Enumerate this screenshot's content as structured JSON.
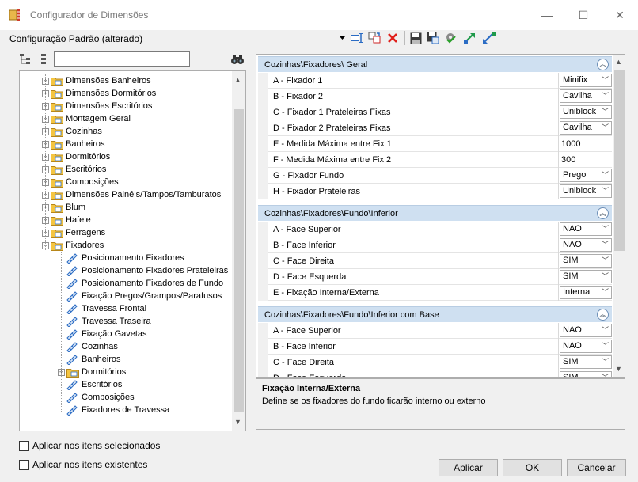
{
  "window": {
    "title": "Configurador de Dimensões",
    "minimize": "—",
    "maximize": "☐",
    "close": "✕"
  },
  "header": {
    "config_label": "Configuração Padrão (alterado)"
  },
  "search": {
    "value": "",
    "placeholder": ""
  },
  "tree": {
    "nodes": [
      {
        "label": "Dimensões Banheiros",
        "type": "folder",
        "expander": "+"
      },
      {
        "label": "Dimensões Dormitórios",
        "type": "folder",
        "expander": "+"
      },
      {
        "label": "Dimensões Escritórios",
        "type": "folder",
        "expander": "+"
      },
      {
        "label": "Montagem Geral",
        "type": "folder",
        "expander": "+"
      },
      {
        "label": "Cozinhas",
        "type": "folder",
        "expander": "+"
      },
      {
        "label": "Banheiros",
        "type": "folder",
        "expander": "+"
      },
      {
        "label": "Dormitórios",
        "type": "folder",
        "expander": "+"
      },
      {
        "label": "Escritórios",
        "type": "folder",
        "expander": "+"
      },
      {
        "label": "Composições",
        "type": "folder",
        "expander": "+"
      },
      {
        "label": "Dimensões Painéis/Tampos/Tamburatos",
        "type": "folder",
        "expander": "+"
      },
      {
        "label": "Blum",
        "type": "folder",
        "expander": "+"
      },
      {
        "label": "Hafele",
        "type": "folder",
        "expander": "+"
      },
      {
        "label": "Ferragens",
        "type": "folder",
        "expander": "+"
      },
      {
        "label": "Fixadores",
        "type": "folder",
        "expander": "−"
      },
      {
        "label": "Posicionamento Fixadores",
        "type": "leaf"
      },
      {
        "label": "Posicionamento Fixadores Prateleiras",
        "type": "leaf"
      },
      {
        "label": "Posicionamento Fixadores de Fundo",
        "type": "leaf"
      },
      {
        "label": "Fixação Pregos/Grampos/Parafusos",
        "type": "leaf"
      },
      {
        "label": "Travessa Frontal",
        "type": "leaf"
      },
      {
        "label": "Travessa Traseira",
        "type": "leaf"
      },
      {
        "label": "Fixação Gavetas",
        "type": "leaf"
      },
      {
        "label": "Cozinhas",
        "type": "leaf"
      },
      {
        "label": "Banheiros",
        "type": "leaf"
      },
      {
        "label": "Dormitórios",
        "type": "folder",
        "expander": "+"
      },
      {
        "label": "Escritórios",
        "type": "leaf"
      },
      {
        "label": "Composições",
        "type": "leaf"
      },
      {
        "label": "Fixadores de Travessa",
        "type": "leaf"
      }
    ]
  },
  "grid": {
    "categories": [
      {
        "title": "Cozinhas\\Fixadores\\ Geral",
        "collapse": "︽",
        "rows": [
          {
            "name": "A - Fixador 1",
            "value": "Minifix",
            "combo": true
          },
          {
            "name": "B - Fixador 2",
            "value": "Cavilha",
            "combo": true
          },
          {
            "name": "C - Fixador 1 Prateleiras Fixas",
            "value": "Uniblock",
            "combo": true
          },
          {
            "name": "D - Fixador 2 Prateleiras Fixas",
            "value": "Cavilha",
            "combo": true
          },
          {
            "name": "E - Medida Máxima entre Fix 1",
            "value": "1000",
            "combo": false
          },
          {
            "name": "F - Medida Máxima entre Fix 2",
            "value": "300",
            "combo": false
          },
          {
            "name": "G - Fixador Fundo",
            "value": "Prego",
            "combo": true
          },
          {
            "name": "H - Fixador Prateleiras",
            "value": "Uniblock",
            "combo": true
          }
        ]
      },
      {
        "title": "Cozinhas\\Fixadores\\Fundo\\Inferior",
        "collapse": "︽",
        "rows": [
          {
            "name": "A - Face Superior",
            "value": "NAO",
            "combo": true
          },
          {
            "name": "B - Face Inferior",
            "value": "NAO",
            "combo": true
          },
          {
            "name": "C - Face Direita",
            "value": "SIM",
            "combo": true
          },
          {
            "name": "D - Face Esquerda",
            "value": "SIM",
            "combo": true
          },
          {
            "name": "E - Fixação Interna/Externa",
            "value": "Interna",
            "combo": true
          }
        ]
      },
      {
        "title": "Cozinhas\\Fixadores\\Fundo\\Inferior com Base",
        "collapse": "︽",
        "rows": [
          {
            "name": "A - Face Superior",
            "value": "NAO",
            "combo": true
          },
          {
            "name": "B - Face Inferior",
            "value": "NAO",
            "combo": true
          },
          {
            "name": "C - Face Direita",
            "value": "SIM",
            "combo": true
          },
          {
            "name": "D - Face Esquerda",
            "value": "SIM",
            "combo": true
          }
        ]
      }
    ]
  },
  "description": {
    "title": "Fixação Interna/Externa",
    "text": "Define se os fixadores do fundo ficarão interno ou externo"
  },
  "options": {
    "apply_selected": "Aplicar nos itens selecionados",
    "apply_existing": "Aplicar nos itens existentes"
  },
  "buttons": {
    "apply": "Aplicar",
    "ok": "OK",
    "cancel": "Cancelar"
  },
  "colors": {
    "category_bg": "#cfe0f1",
    "folder_yellow": "#f4c542",
    "accent_blue": "#2b6cc4"
  }
}
